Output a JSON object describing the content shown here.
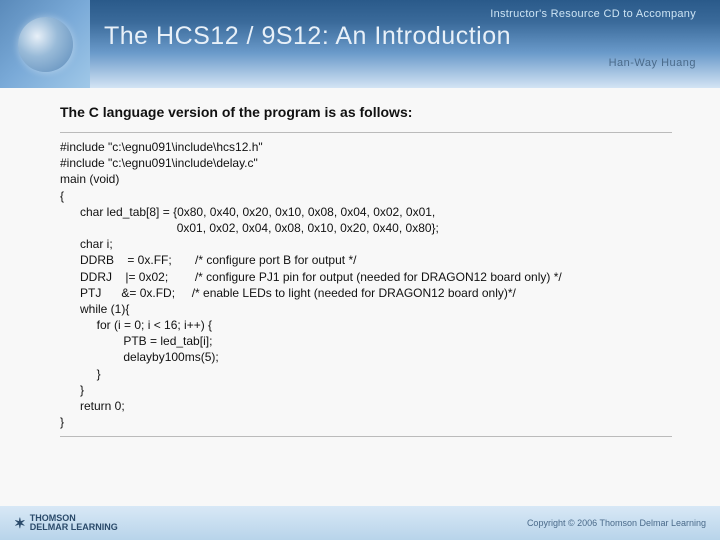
{
  "header": {
    "topline": "Instructor's Resource CD to Accompany",
    "title": "The HCS12 / 9S12: An Introduction",
    "author": "Han-Way Huang"
  },
  "content": {
    "title": "The C language version of the program is as follows:",
    "code": "#include \"c:\\egnu091\\include\\hcs12.h\"\n#include \"c:\\egnu091\\include\\delay.c\"\nmain (void)\n{\n      char led_tab[8] = {0x80, 0x40, 0x20, 0x10, 0x08, 0x04, 0x02, 0x01,\n                                   0x01, 0x02, 0x04, 0x08, 0x10, 0x20, 0x40, 0x80};\n      char i;\n      DDRB    = 0x.FF;       /* configure port B for output */\n      DDRJ    |= 0x02;        /* configure PJ1 pin for output (needed for DRAGON12 board only) */\n      PTJ      &= 0x.FD;     /* enable LEDs to light (needed for DRAGON12 board only)*/\n      while (1){\n           for (i = 0; i < 16; i++) {\n                   PTB = led_tab[i];\n                   delayby100ms(5);\n           }\n      }\n      return 0;\n}"
  },
  "footer": {
    "brand_top": "THOMSON",
    "brand_bottom": "DELMAR LEARNING",
    "copyright": "Copyright © 2006 Thomson Delmar Learning"
  }
}
